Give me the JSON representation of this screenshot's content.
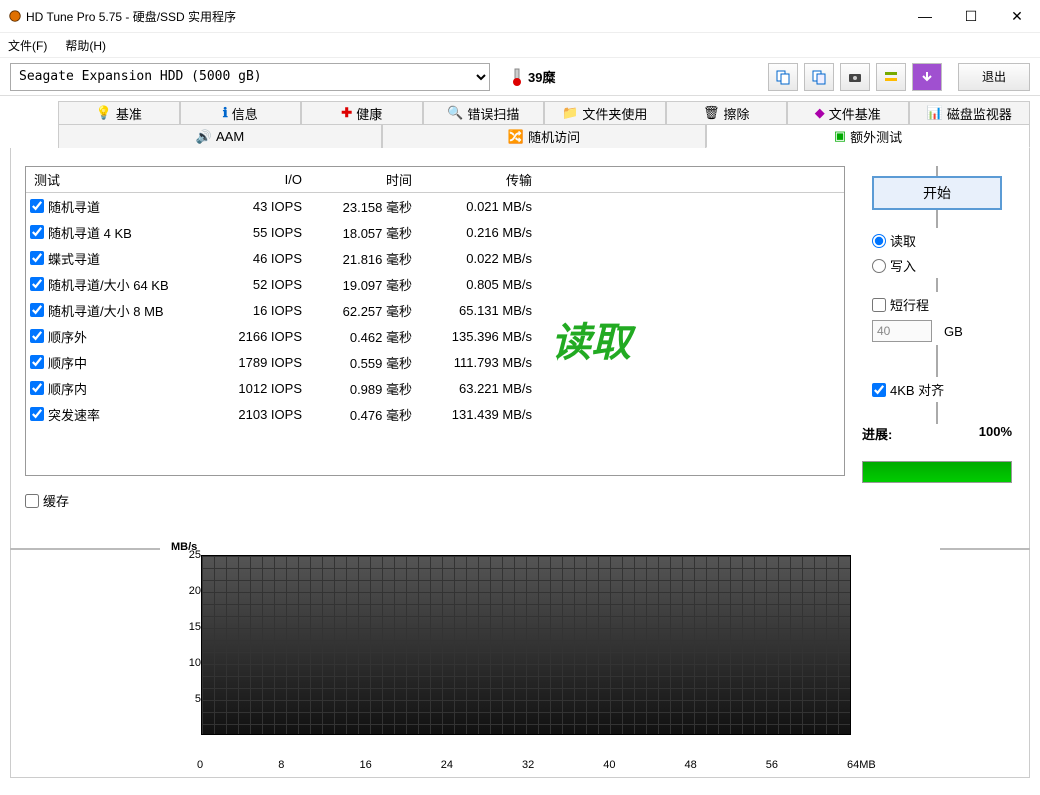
{
  "window": {
    "title": "HD Tune Pro 5.75 - 硬盘/SSD 实用程序"
  },
  "menu": {
    "file": "文件(F)",
    "help": "帮助(H)"
  },
  "toolbar": {
    "device": "Seagate Expansion HDD (5000 gB)",
    "temp": "39糜",
    "exit": "退出"
  },
  "tabs_row1": [
    "基准",
    "信息",
    "健康",
    "错误扫描",
    "文件夹使用",
    "擦除",
    "文件基准",
    "磁盘监视器"
  ],
  "tabs_row2": [
    "AAM",
    "随机访问",
    "额外测试"
  ],
  "active_tab": "额外测试",
  "table": {
    "headers": [
      "测试",
      "I/O",
      "时间",
      "传输"
    ],
    "rows": [
      {
        "name": "随机寻道",
        "io": "43 IOPS",
        "time": "23.158 毫秒",
        "xfer": "0.021 MB/s",
        "checked": true
      },
      {
        "name": "随机寻道 4 KB",
        "io": "55 IOPS",
        "time": "18.057 毫秒",
        "xfer": "0.216 MB/s",
        "checked": true
      },
      {
        "name": "蝶式寻道",
        "io": "46 IOPS",
        "time": "21.816 毫秒",
        "xfer": "0.022 MB/s",
        "checked": true
      },
      {
        "name": "随机寻道/大小 64 KB",
        "io": "52 IOPS",
        "time": "19.097 毫秒",
        "xfer": "0.805 MB/s",
        "checked": true
      },
      {
        "name": "随机寻道/大小 8 MB",
        "io": "16 IOPS",
        "time": "62.257 毫秒",
        "xfer": "65.131 MB/s",
        "checked": true
      },
      {
        "name": "顺序外",
        "io": "2166 IOPS",
        "time": "0.462 毫秒",
        "xfer": "135.396 MB/s",
        "checked": true
      },
      {
        "name": "顺序中",
        "io": "1789 IOPS",
        "time": "0.559 毫秒",
        "xfer": "111.793 MB/s",
        "checked": true
      },
      {
        "name": "顺序内",
        "io": "1012 IOPS",
        "time": "0.989 毫秒",
        "xfer": "63.221 MB/s",
        "checked": true
      },
      {
        "name": "突发速率",
        "io": "2103 IOPS",
        "time": "0.476 毫秒",
        "xfer": "131.439 MB/s",
        "checked": true
      }
    ]
  },
  "overlay": "读取",
  "side": {
    "start": "开始",
    "read": "读取",
    "write": "写入",
    "short": "短行程",
    "short_val": "40",
    "gb": "GB",
    "align": "4KB 对齐",
    "progress_label": "进展:",
    "progress_val": "100%"
  },
  "cache": "缓存",
  "chart_data": {
    "type": "line",
    "title": "",
    "ylabel": "MB/s",
    "xlabel": "MB",
    "x_ticks": [
      0,
      8,
      16,
      24,
      32,
      40,
      48,
      56,
      64
    ],
    "y_ticks": [
      5,
      10,
      15,
      20,
      25
    ],
    "xlim": [
      0,
      64
    ],
    "ylim": [
      0,
      25
    ],
    "series": []
  }
}
